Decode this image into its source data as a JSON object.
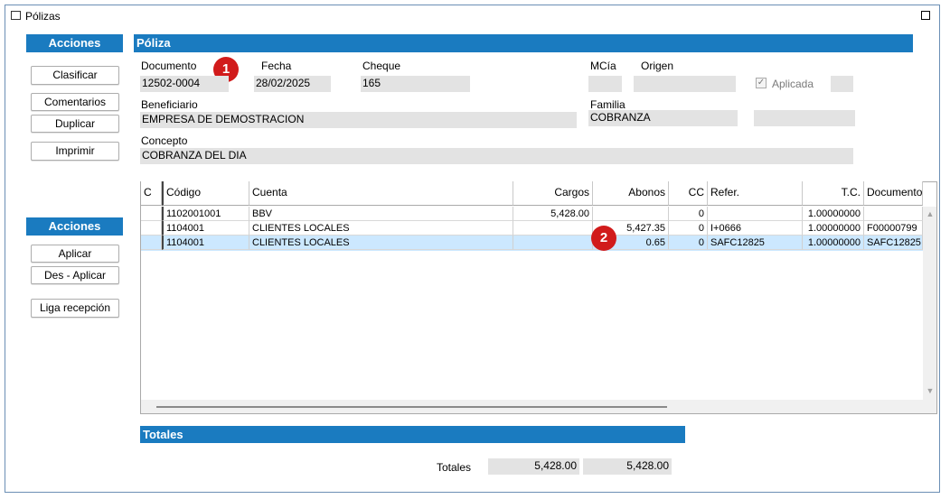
{
  "window": {
    "title": "Pólizas"
  },
  "sidebar": {
    "actions_header": "Acciones",
    "buttons": [
      "Clasificar",
      "Comentarios",
      "Duplicar",
      "Imprimir"
    ],
    "actions_header2": "Acciones",
    "buttons2": [
      "Aplicar",
      "Des - Aplicar",
      "Liga recepción"
    ]
  },
  "poliza": {
    "header": "Póliza",
    "labels": {
      "documento": "Documento",
      "fecha": "Fecha",
      "cheque": "Cheque",
      "mcia": "MCía",
      "origen": "Origen",
      "aplicada": "Aplicada",
      "beneficiario": "Beneficiario",
      "familia": "Familia",
      "concepto": "Concepto"
    },
    "values": {
      "documento": "12502-0004",
      "fecha": "28/02/2025",
      "cheque": "165",
      "mcia": "",
      "origen": "",
      "beneficiario": "EMPRESA DE DEMOSTRACION",
      "familia": "COBRANZA",
      "concepto": "COBRANZA DEL DIA"
    },
    "aplicada_checked": true
  },
  "badges": {
    "one": "1",
    "two": "2"
  },
  "grid": {
    "columns": [
      "C",
      "Código",
      "Cuenta",
      "Cargos",
      "Abonos",
      "CC",
      "Refer.",
      "T.C.",
      "Documento"
    ],
    "rows": [
      {
        "c": "",
        "codigo": "1102001001",
        "cuenta": "BBV",
        "cargos": "5,428.00",
        "abonos": "",
        "cc": "0",
        "refer": "",
        "tc": "1.00000000",
        "documento": ""
      },
      {
        "c": "",
        "codigo": "1104001",
        "cuenta": "CLIENTES LOCALES",
        "cargos": "",
        "abonos": "5,427.35",
        "cc": "0",
        "refer": "I+0666",
        "tc": "1.00000000",
        "documento": "F00000799"
      },
      {
        "c": "",
        "codigo": "1104001",
        "cuenta": "CLIENTES LOCALES",
        "cargos": "",
        "abonos": "0.65",
        "cc": "0",
        "refer": "SAFC12825",
        "tc": "1.00000000",
        "documento": "SAFC12825"
      }
    ],
    "selected_row": 2
  },
  "totales": {
    "header": "Totales",
    "label": "Totales",
    "cargos": "5,428.00",
    "abonos": "5,428.00"
  },
  "colors": {
    "accent": "#1a7bc0",
    "selected_row": "#cce8ff",
    "badge": "#d11b1b"
  }
}
